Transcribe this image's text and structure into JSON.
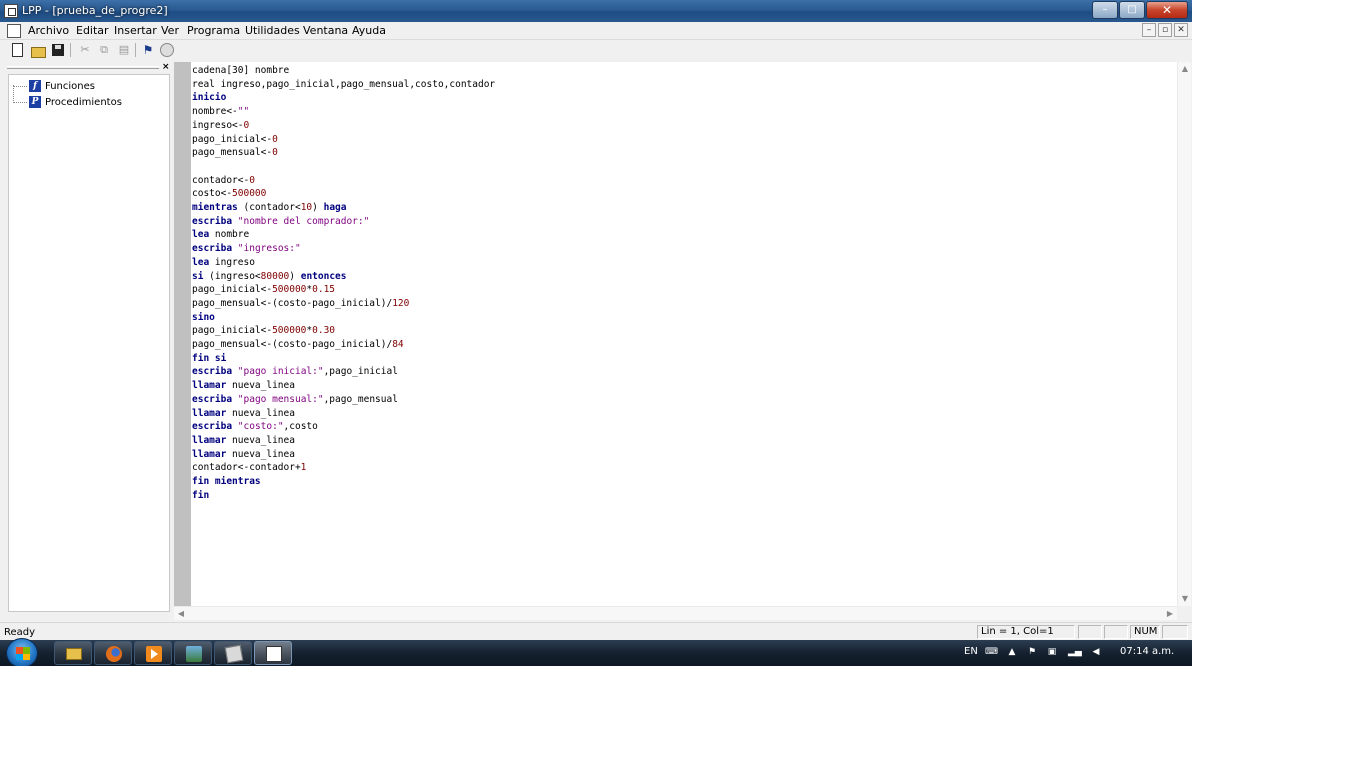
{
  "window": {
    "title": "LPP - [prueba_de_progre2]",
    "minimize": "–",
    "maximize": "□",
    "close": "✕"
  },
  "menu": {
    "items": [
      "Archivo",
      "Editar",
      "Insertar",
      "Ver",
      "Programa",
      "Utilidades",
      "Ventana",
      "Ayuda"
    ],
    "mdi_minimize": "–",
    "mdi_restore": "▫",
    "mdi_close": "✕"
  },
  "toolbar": {
    "cut": "✂",
    "copy": "⧉",
    "paste": "▤",
    "run": "⚑",
    "icons": [
      "new-file-icon",
      "open-folder-icon",
      "save-icon",
      "cut-icon",
      "copy-icon",
      "paste-icon",
      "run-icon",
      "compile-icon"
    ]
  },
  "side_panel": {
    "close": "×",
    "items": [
      {
        "icon_letter": "f",
        "label": "Funciones"
      },
      {
        "icon_letter": "P",
        "label": "Procedimientos"
      }
    ]
  },
  "editor": {
    "lines": [
      [
        {
          "t": "cadena[30] nombre",
          "c": "p"
        }
      ],
      [
        {
          "t": "real ingreso,pago_inicial,pago_mensual,costo,contador",
          "c": "p"
        }
      ],
      [
        {
          "t": "inicio",
          "c": "k"
        }
      ],
      [
        {
          "t": "nombre<-",
          "c": "p"
        },
        {
          "t": "\"\"",
          "c": "s"
        }
      ],
      [
        {
          "t": "ingreso<-",
          "c": "p"
        },
        {
          "t": "0",
          "c": "n"
        }
      ],
      [
        {
          "t": "pago_inicial<-",
          "c": "p"
        },
        {
          "t": "0",
          "c": "n"
        }
      ],
      [
        {
          "t": "pago_mensual<-",
          "c": "p"
        },
        {
          "t": "0",
          "c": "n"
        }
      ],
      [],
      [
        {
          "t": "contador<-",
          "c": "p"
        },
        {
          "t": "0",
          "c": "n"
        }
      ],
      [
        {
          "t": "costo<-",
          "c": "p"
        },
        {
          "t": "500000",
          "c": "n"
        }
      ],
      [
        {
          "t": "mientras",
          "c": "k"
        },
        {
          "t": " (contador<",
          "c": "p"
        },
        {
          "t": "10",
          "c": "n"
        },
        {
          "t": ") ",
          "c": "p"
        },
        {
          "t": "haga",
          "c": "k"
        }
      ],
      [
        {
          "t": "escriba",
          "c": "k"
        },
        {
          "t": " ",
          "c": "p"
        },
        {
          "t": "\"nombre del comprador:\"",
          "c": "s"
        }
      ],
      [
        {
          "t": "lea",
          "c": "k"
        },
        {
          "t": " nombre",
          "c": "p"
        }
      ],
      [
        {
          "t": "escriba",
          "c": "k"
        },
        {
          "t": " ",
          "c": "p"
        },
        {
          "t": "\"ingresos:\"",
          "c": "s"
        }
      ],
      [
        {
          "t": "lea",
          "c": "k"
        },
        {
          "t": " ingreso",
          "c": "p"
        }
      ],
      [
        {
          "t": "si",
          "c": "k"
        },
        {
          "t": " (ingreso<",
          "c": "p"
        },
        {
          "t": "80000",
          "c": "n"
        },
        {
          "t": ") ",
          "c": "p"
        },
        {
          "t": "entonces",
          "c": "k"
        }
      ],
      [
        {
          "t": "pago_inicial<-",
          "c": "p"
        },
        {
          "t": "500000",
          "c": "n"
        },
        {
          "t": "*",
          "c": "p"
        },
        {
          "t": "0.15",
          "c": "n"
        }
      ],
      [
        {
          "t": "pago_mensual<-(costo-pago_inicial)/",
          "c": "p"
        },
        {
          "t": "120",
          "c": "n"
        }
      ],
      [
        {
          "t": "sino",
          "c": "k"
        }
      ],
      [
        {
          "t": "pago_inicial<-",
          "c": "p"
        },
        {
          "t": "500000",
          "c": "n"
        },
        {
          "t": "*",
          "c": "p"
        },
        {
          "t": "0.30",
          "c": "n"
        }
      ],
      [
        {
          "t": "pago_mensual<-(costo-pago_inicial)/",
          "c": "p"
        },
        {
          "t": "84",
          "c": "n"
        }
      ],
      [
        {
          "t": "fin si",
          "c": "k"
        }
      ],
      [
        {
          "t": "escriba",
          "c": "k"
        },
        {
          "t": " ",
          "c": "p"
        },
        {
          "t": "\"pago inicial:\"",
          "c": "s"
        },
        {
          "t": ",pago_inicial",
          "c": "p"
        }
      ],
      [
        {
          "t": "llamar",
          "c": "k"
        },
        {
          "t": " nueva_linea",
          "c": "p"
        }
      ],
      [
        {
          "t": "escriba",
          "c": "k"
        },
        {
          "t": " ",
          "c": "p"
        },
        {
          "t": "\"pago mensual:\"",
          "c": "s"
        },
        {
          "t": ",pago_mensual",
          "c": "p"
        }
      ],
      [
        {
          "t": "llamar",
          "c": "k"
        },
        {
          "t": " nueva_linea",
          "c": "p"
        }
      ],
      [
        {
          "t": "escriba",
          "c": "k"
        },
        {
          "t": " ",
          "c": "p"
        },
        {
          "t": "\"costo:\"",
          "c": "s"
        },
        {
          "t": ",costo",
          "c": "p"
        }
      ],
      [
        {
          "t": "llamar",
          "c": "k"
        },
        {
          "t": " nueva_linea",
          "c": "p"
        }
      ],
      [
        {
          "t": "llamar",
          "c": "k"
        },
        {
          "t": " nueva_linea",
          "c": "p"
        }
      ],
      [
        {
          "t": "contador<-contador+",
          "c": "p"
        },
        {
          "t": "1",
          "c": "n"
        }
      ],
      [
        {
          "t": "fin mientras",
          "c": "k"
        }
      ],
      [
        {
          "t": "fin",
          "c": "k"
        }
      ]
    ],
    "token_colors": {
      "k": "#00007f",
      "p": "#000000",
      "s": "#7f007f",
      "n": "#7f0000"
    }
  },
  "statusbar": {
    "ready": "Ready",
    "position": "Lin = 1, Col=1",
    "num": "NUM"
  },
  "taskbar": {
    "apps": [
      "explorer-icon",
      "firefox-icon",
      "media-player-icon",
      "network-icon",
      "folder-icon",
      "lpp-icon"
    ],
    "tray": {
      "lang": "EN",
      "up": "▲",
      "clock": "07:14 a.m."
    }
  },
  "colors": {
    "titlebar": "#2a5b92",
    "keyword": "#00007f",
    "string": "#7f007f",
    "number": "#7f0000",
    "taskbar": "#15212f"
  }
}
